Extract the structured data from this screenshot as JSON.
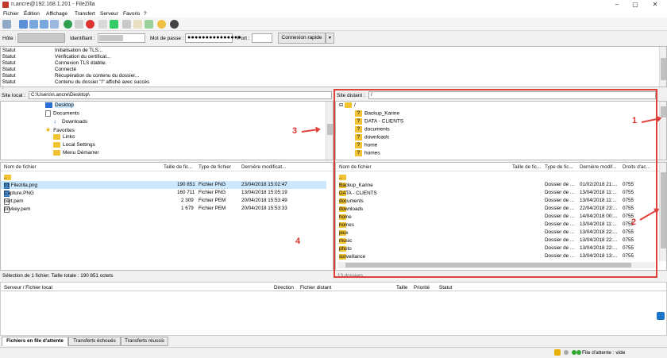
{
  "window": {
    "title": "n.ancre@192.168.1.201 - FileZilla"
  },
  "menu": [
    "Fichier",
    "Édition",
    "Affichage",
    "Transfert",
    "Serveur",
    "Favoris",
    "?"
  ],
  "quickconnect": {
    "host_label": "Hôte :",
    "user_label": "Identifiant :",
    "password_label": "Mot de passe :",
    "password_value": "●●●●●●●●●●●●●●●",
    "port_label": "Port :",
    "connect_button": "Connexion rapide",
    "dropdown_icon": "▼"
  },
  "log": [
    {
      "k": "Statut :",
      "v": "Initialisation de TLS..."
    },
    {
      "k": "Statut :",
      "v": "Vérification du certificat..."
    },
    {
      "k": "Statut :",
      "v": "Connexion TLS établie."
    },
    {
      "k": "Statut :",
      "v": "Connecté"
    },
    {
      "k": "Statut :",
      "v": "Récupération du contenu du dossier..."
    },
    {
      "k": "Statut :",
      "v": "Contenu du dossier \"/\" affiché avec succès"
    }
  ],
  "local": {
    "site_label": "Site local :",
    "path": "C:\\Users\\n.ancre\\Desktop\\",
    "tree": [
      "Desktop",
      "Documents",
      "Downloads",
      "Favorites",
      "Links",
      "Local Settings",
      "Menu Démarrer"
    ],
    "columns": [
      "Nom de fichier",
      "Taille de fic...",
      "Type de fichier",
      "Dernière modificat..."
    ],
    "files": [
      {
        "name": "..",
        "size": "",
        "type": "",
        "date": ""
      },
      {
        "name": "01 Filezilla.png",
        "size": "190 851",
        "type": "Fichier PNG",
        "date": "23/04/2018 15:02:47"
      },
      {
        "name": "Capture.PNG",
        "size": "160 711",
        "type": "Fichier PNG",
        "date": "13/04/2018 15:05:19"
      },
      {
        "name": "cert.pem",
        "size": "2 309",
        "type": "Fichier PEM",
        "date": "20/04/2018 15:53:49"
      },
      {
        "name": "privkey.pem",
        "size": "1 679",
        "type": "Fichier PEM",
        "date": "20/04/2018 15:53:33"
      }
    ],
    "status": "Sélection de 1 fichier. Taille totale : 190 851 octets"
  },
  "remote": {
    "site_label": "Site distant :",
    "path": "/",
    "tree": [
      "/",
      "Backup_Karine",
      "DATA - CLIENTS",
      "documents",
      "downloads",
      "home",
      "homes"
    ],
    "columns": [
      "Nom de fichier",
      "Taille de fic...",
      "Type de fic...",
      "Dernière modif...",
      "Droits d'ac..."
    ],
    "files": [
      {
        "name": "..",
        "size": "",
        "type": "",
        "date": "",
        "perm": ""
      },
      {
        "name": "Backup_Karine",
        "size": "",
        "type": "Dossier de ...",
        "date": "01/02/2018 21:...",
        "perm": "0755"
      },
      {
        "name": "DATA - CLIENTS",
        "size": "",
        "type": "Dossier de ...",
        "date": "13/04/2018 11:...",
        "perm": "0755"
      },
      {
        "name": "documents",
        "size": "",
        "type": "Dossier de ...",
        "date": "13/04/2018 11:...",
        "perm": "0755"
      },
      {
        "name": "downloads",
        "size": "",
        "type": "Dossier de ...",
        "date": "22/04/2018 23:...",
        "perm": "0755"
      },
      {
        "name": "home",
        "size": "",
        "type": "Dossier de ...",
        "date": "14/04/2018 00:...",
        "perm": "0755"
      },
      {
        "name": "homes",
        "size": "",
        "type": "Dossier de ...",
        "date": "13/04/2018 11:...",
        "perm": "0755"
      },
      {
        "name": "jeux",
        "size": "",
        "type": "Dossier de ...",
        "date": "13/04/2018 22:...",
        "perm": "0755"
      },
      {
        "name": "music",
        "size": "",
        "type": "Dossier de ...",
        "date": "13/04/2018 22:...",
        "perm": "0755"
      },
      {
        "name": "photo",
        "size": "",
        "type": "Dossier de ...",
        "date": "13/04/2018 22:...",
        "perm": "0755"
      },
      {
        "name": "surveillance",
        "size": "",
        "type": "Dossier de ...",
        "date": "13/04/2018 13:...",
        "perm": "0755"
      }
    ],
    "status": "13 dossiers"
  },
  "queue": {
    "columns": [
      "Serveur / Fichier local",
      "Direction",
      "Fichier distant",
      "Taille",
      "Priorité",
      "Statut"
    ]
  },
  "tabs": [
    "Fichiers en file d'attente",
    "Transferts échoués",
    "Transferts réussis"
  ],
  "statusbar": {
    "queue": "File d'attente : vide"
  },
  "annotations": [
    "1",
    "2",
    "3",
    "4"
  ],
  "colors": {
    "annotation": "#e0403a",
    "folder": "#f1c232",
    "selection": "#cce8ff"
  }
}
